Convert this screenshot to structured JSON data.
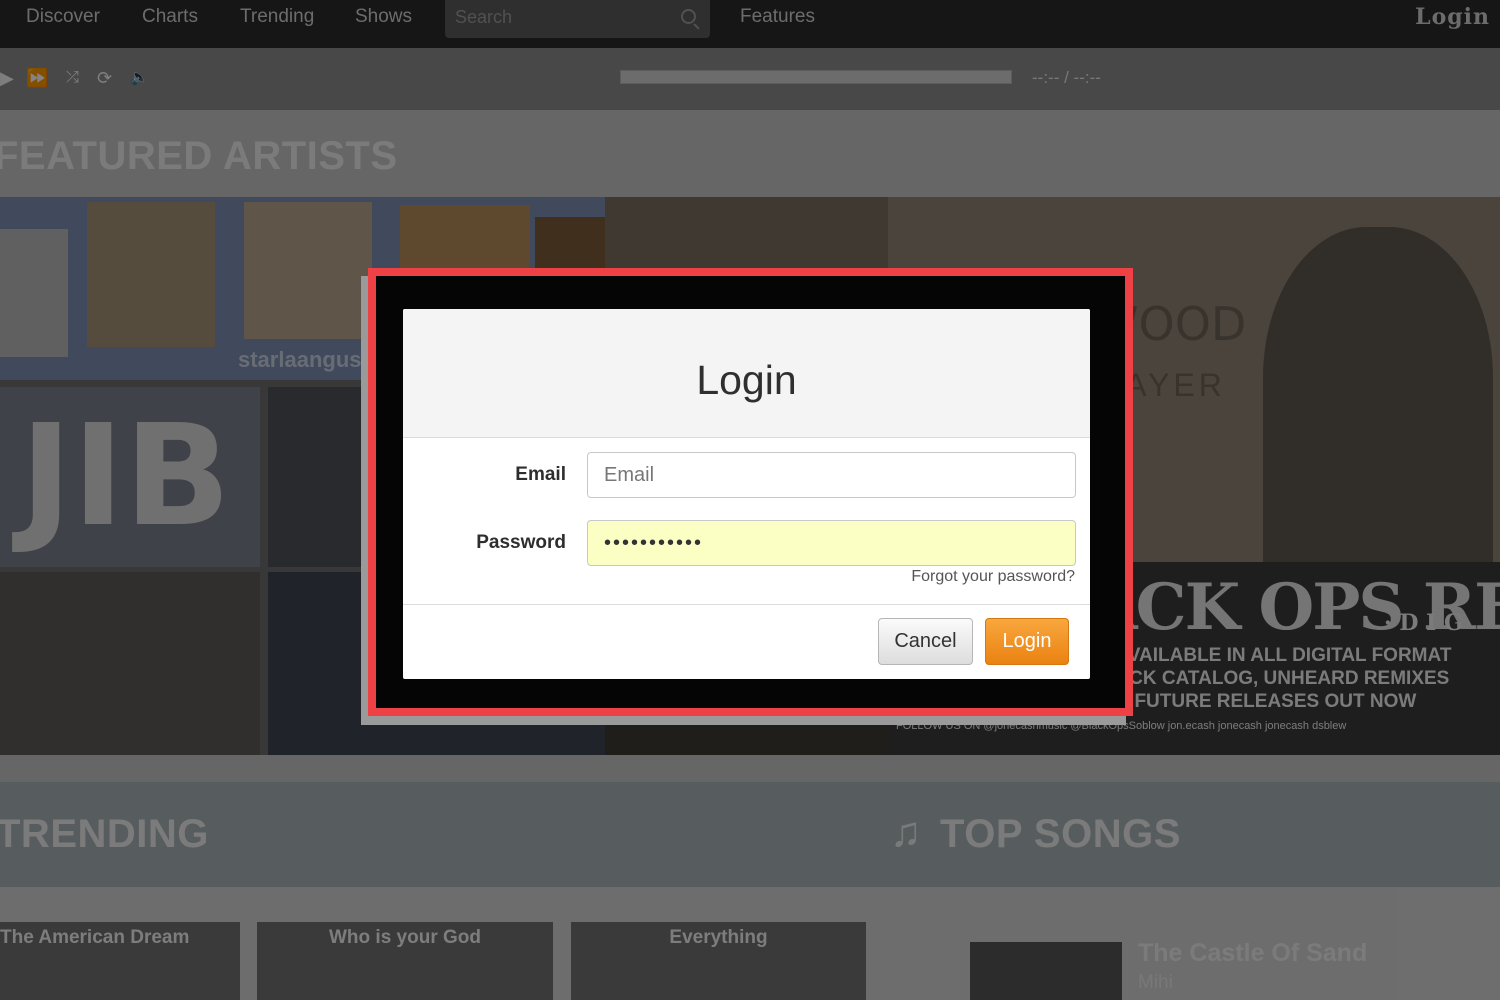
{
  "nav": {
    "items": [
      "Discover",
      "Charts",
      "Trending",
      "Shows"
    ],
    "search_placeholder": "Search",
    "features": "Features",
    "login": "Login"
  },
  "player": {
    "timer": "--:-- / --:--"
  },
  "featured": {
    "title": "FEATURED ARTISTS",
    "tile_texts": {
      "starla": "starlaangus",
      "jib": "JIB",
      "wood": "WOOD",
      "prayer": "RAYER",
      "ops_big": "ACK OPS RECO",
      "ops_sub": "· D I G",
      "ops_lines": [
        "LL AVAILABLE IN ALL DIGITAL FORMAT",
        "LL ACK CATALOG, UNHEARD REMIXES",
        "AND FUTURE RELEASES  OUT NOW"
      ],
      "ops_follow": "FOLLOW US ON  @jonecashmusic  @BlackOpsSoblow  jon.ecash  jonecash  jonecash  dsblew"
    }
  },
  "trending": {
    "title": "TRENDING",
    "cards": [
      "The American Dream",
      "Who is your God",
      "Everything"
    ]
  },
  "top_songs": {
    "title": "TOP SONGS",
    "song_title": "The Castle Of Sand",
    "song_artist": "Mihi"
  },
  "login_modal": {
    "title": "Login",
    "email_label": "Email",
    "email_placeholder": "Email",
    "password_label": "Password",
    "password_value": "•••••••••••",
    "forgot_link": "Forgot your password?",
    "cancel_label": "Cancel",
    "login_label": "Login"
  },
  "colors": {
    "highlight_border": "#ee4146",
    "login_button": "#f0931f",
    "autofill_bg": "#fbffc3"
  }
}
